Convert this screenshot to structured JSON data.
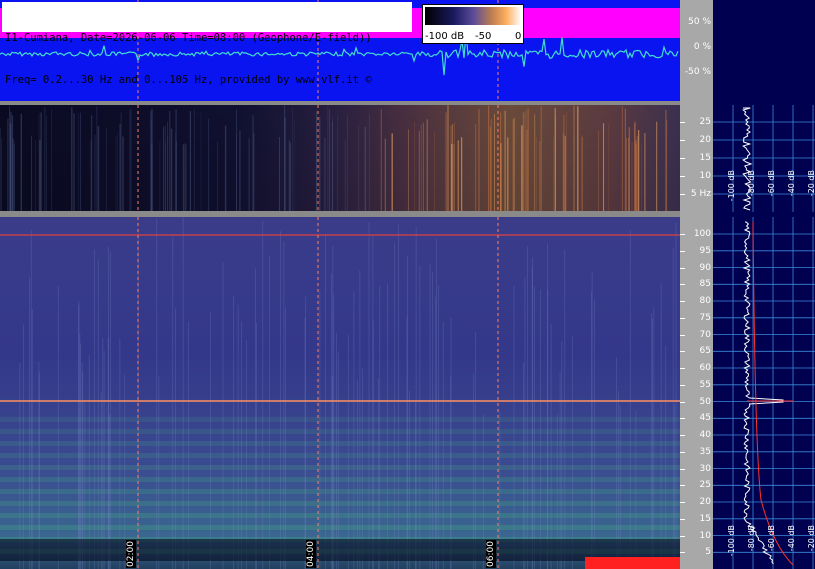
{
  "header": {
    "line1": "I1-Cumiana, Date=2026-06-06 Time=08:00 (Geophone/E-field))",
    "line2": "Freq= 0.2...30 Hz and 0...105 Hz, provided by www.vlf.it ©"
  },
  "colorbar": {
    "ticks": [
      "-100 dB",
      "-50",
      "0"
    ]
  },
  "waveform_axis": [
    "50 %",
    "0 %",
    "-50 %"
  ],
  "low_axis": [
    "25",
    "20",
    "15",
    "10",
    "5 Hz"
  ],
  "main_axis": [
    "100",
    "95",
    "90",
    "85",
    "80",
    "75",
    "70",
    "65",
    "60",
    "55",
    "50",
    "45",
    "40",
    "35",
    "30",
    "25",
    "20",
    "15",
    "10",
    "5"
  ],
  "time_labels": [
    "02:00",
    "04:00",
    "06:00"
  ],
  "side_axis_top": [
    "-100 dB",
    "-80 dB",
    "-60 dB",
    "-40 dB",
    "-20 dB"
  ],
  "side_axis_bottom": [
    "-100 dB",
    "-80 dB",
    "-60 dB",
    "-40 dB",
    "-20 dB"
  ],
  "colors": {
    "waveform_bg": "#0a14f0",
    "magenta": "#ff00ff",
    "trace": "#40e0d0",
    "marker": "#ff8060",
    "grid": "#3a8ad8"
  }
}
